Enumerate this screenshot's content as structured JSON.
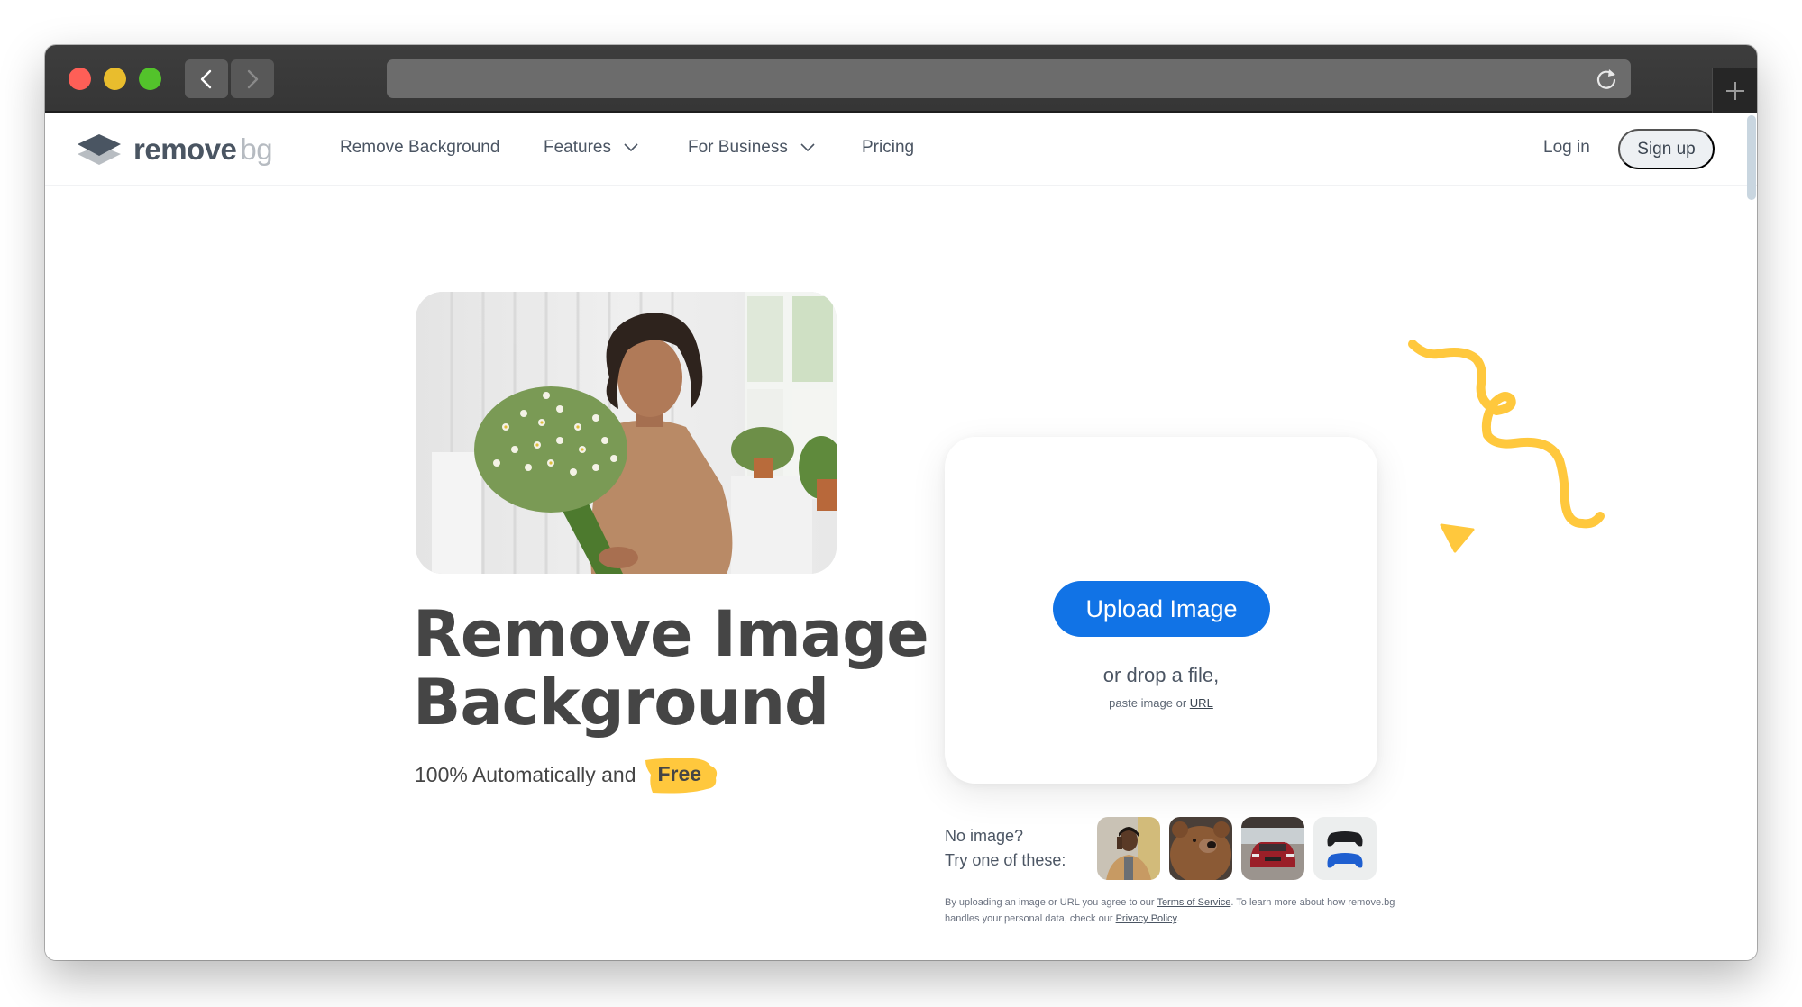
{
  "browser": {
    "address": "",
    "back_label": "Back",
    "forward_label": "Forward"
  },
  "header": {
    "logo": {
      "part1": "remove",
      "part2": "bg"
    },
    "nav": [
      {
        "label": "Remove Background",
        "has_dropdown": false
      },
      {
        "label": "Features",
        "has_dropdown": true
      },
      {
        "label": "For Business",
        "has_dropdown": true
      },
      {
        "label": "Pricing",
        "has_dropdown": false
      }
    ],
    "login_label": "Log in",
    "signup_label": "Sign up"
  },
  "hero": {
    "image_alt": "Woman holding a bouquet of chamomile flowers",
    "title_line1": "Remove Image",
    "title_line2": "Background",
    "subtitle": "100% Automatically and",
    "badge": "Free"
  },
  "upload": {
    "button_label": "Upload Image",
    "drop_text": "or drop a file,",
    "paste_prefix": "paste image or",
    "url_link": "URL"
  },
  "samples": {
    "prompt_line1": "No image?",
    "prompt_line2": "Try one of these:",
    "items": [
      {
        "name": "person-on-phone"
      },
      {
        "name": "bear"
      },
      {
        "name": "red-car"
      },
      {
        "name": "game-controllers"
      }
    ]
  },
  "legal": {
    "text1": "By uploading an image or URL you agree to our",
    "terms_link": "Terms of Service",
    "text2": ". To learn more about how remove.bg handles your personal data, check our",
    "privacy_link": "Privacy Policy",
    "text3": "."
  },
  "colors": {
    "accent": "#1173e6",
    "highlight": "#ffc83d",
    "text": "#454545"
  }
}
